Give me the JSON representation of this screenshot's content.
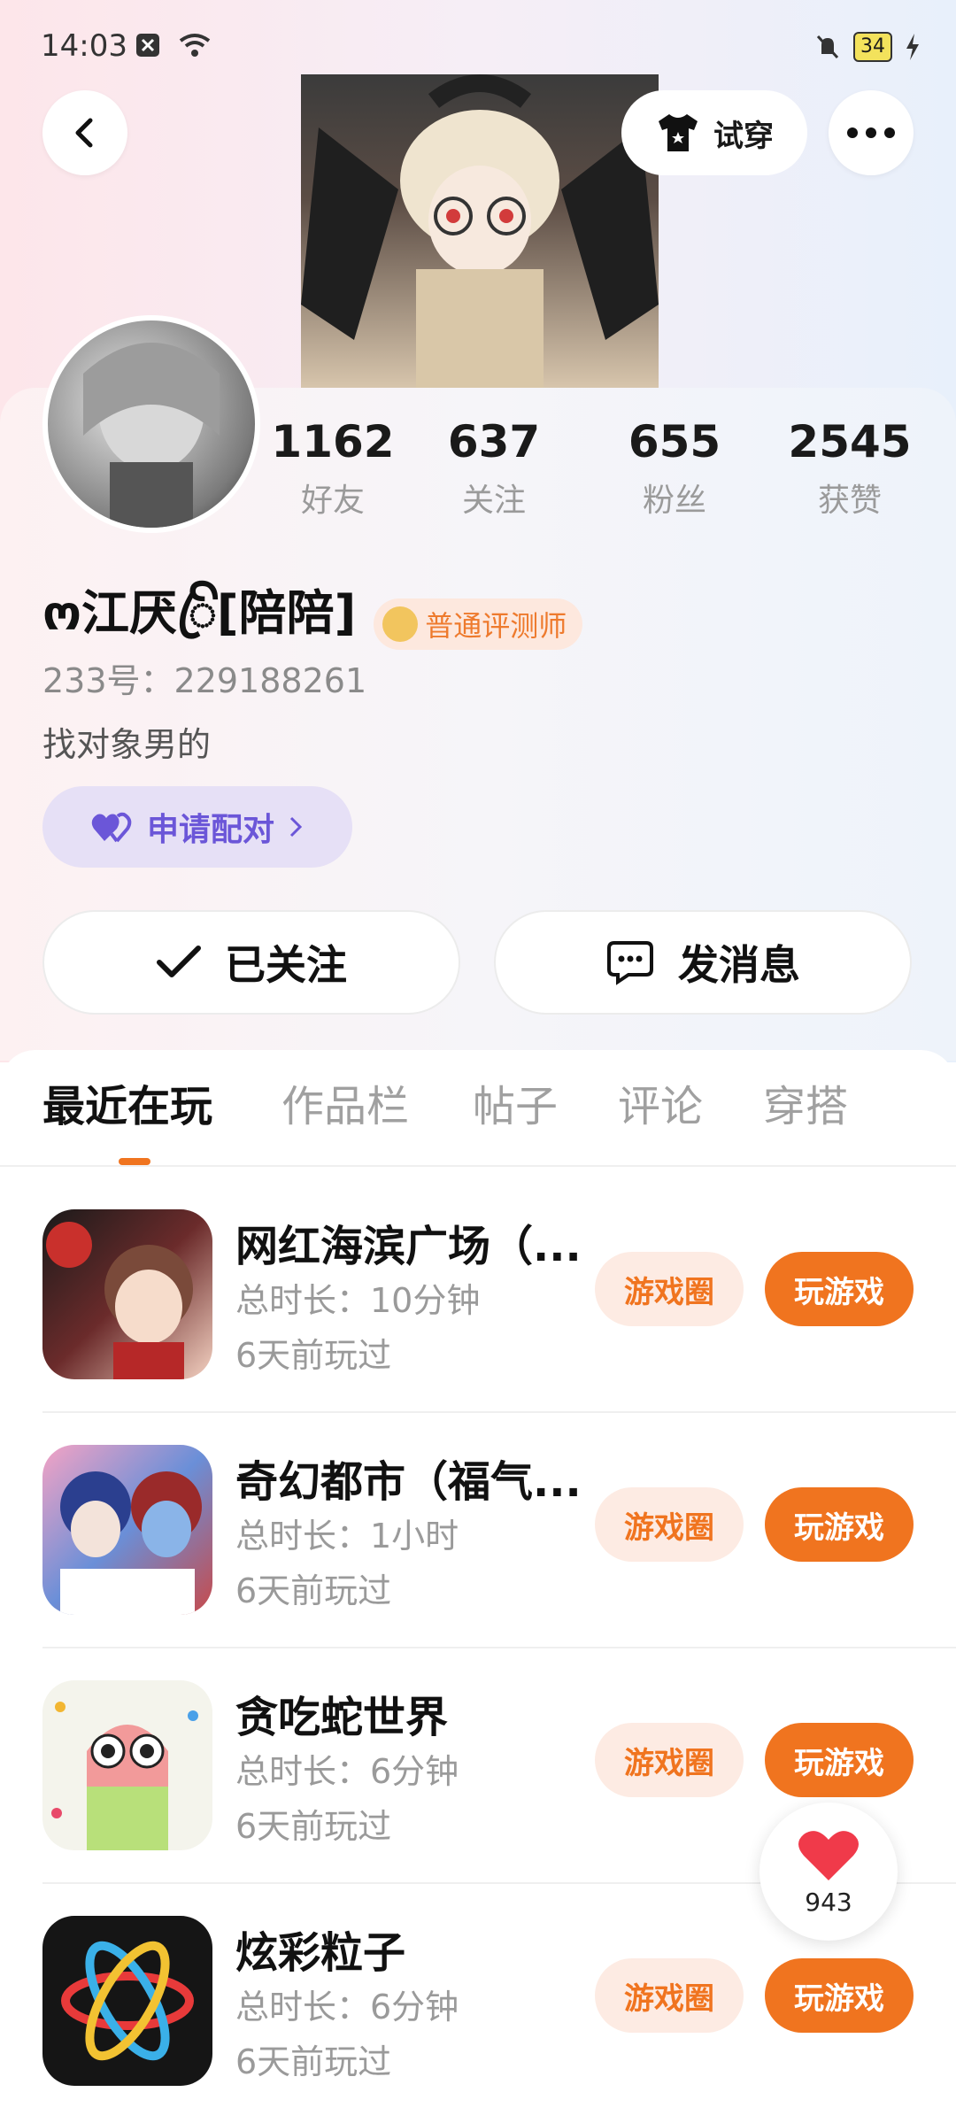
{
  "status": {
    "time": "14:03",
    "battery": "34"
  },
  "header": {
    "tryon_label": "试穿"
  },
  "stats": [
    {
      "value": "1162",
      "label": "好友"
    },
    {
      "value": "637",
      "label": "关注"
    },
    {
      "value": "655",
      "label": "粉丝"
    },
    {
      "value": "2545",
      "label": "获赞"
    }
  ],
  "profile": {
    "name": "ო江厌ꦿꦼ[陪陪]",
    "badge": "普通评测师",
    "id_line": "233号：229188261",
    "bio": "找对象男的",
    "match_label": "申请配对"
  },
  "actions": {
    "follow_label": "已关注",
    "message_label": "发消息"
  },
  "tabs": [
    "最近在玩",
    "作品栏",
    "帖子",
    "评论",
    "穿搭"
  ],
  "games": [
    {
      "title": "网红海滨广场（...",
      "duration": "总时长：10分钟",
      "last_played": "6天前玩过",
      "circle_label": "游戏圈",
      "play_label": "玩游戏"
    },
    {
      "title": "奇幻都市（福气...",
      "duration": "总时长：1小时",
      "last_played": "6天前玩过",
      "circle_label": "游戏圈",
      "play_label": "玩游戏"
    },
    {
      "title": "贪吃蛇世界",
      "duration": "总时长：6分钟",
      "last_played": "6天前玩过",
      "circle_label": "游戏圈",
      "play_label": "玩游戏"
    },
    {
      "title": "炫彩粒子",
      "duration": "总时长：6分钟",
      "last_played": "6天前玩过",
      "circle_label": "游戏圈",
      "play_label": "玩游戏"
    }
  ],
  "like": {
    "count": "943"
  },
  "colors": {
    "accent": "#f0741f",
    "match": "#6b56d8"
  }
}
